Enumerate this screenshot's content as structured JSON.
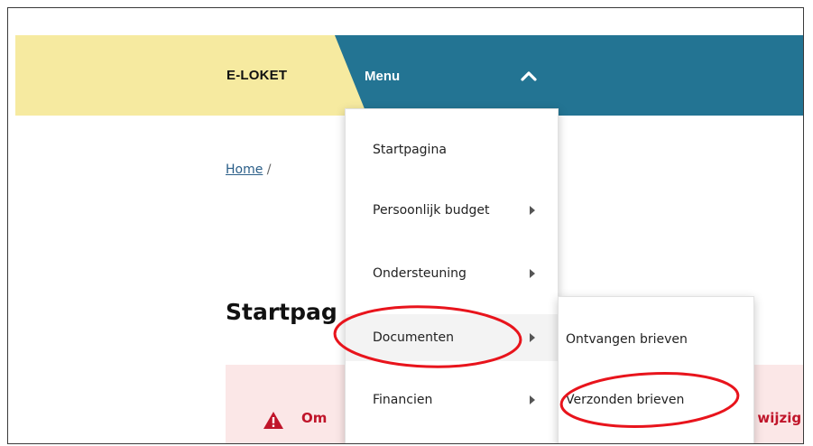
{
  "header": {
    "brand": "E-LOKET",
    "menu_label": "Menu",
    "colors": {
      "brand_bar": "#f6eaa0",
      "nav_bar": "#237493"
    }
  },
  "breadcrumb": {
    "home": "Home",
    "separator": "/"
  },
  "page": {
    "title": "Startpag"
  },
  "alert": {
    "icon": "warning-icon",
    "text_left": "Om",
    "text_right": "e wijzig",
    "color": "#c0152a"
  },
  "menu": {
    "items": [
      {
        "label": "Startpagina",
        "has_submenu": false
      },
      {
        "label": "Persoonlijk budget",
        "has_submenu": true
      },
      {
        "label": "Ondersteuning",
        "has_submenu": true
      },
      {
        "label": "Documenten",
        "has_submenu": true
      },
      {
        "label": "Financien",
        "has_submenu": true
      }
    ]
  },
  "submenu": {
    "items": [
      {
        "label": "Ontvangen brieven"
      },
      {
        "label": "Verzonden brieven"
      }
    ]
  },
  "annotations": {
    "highlight_color": "#e8141c"
  }
}
